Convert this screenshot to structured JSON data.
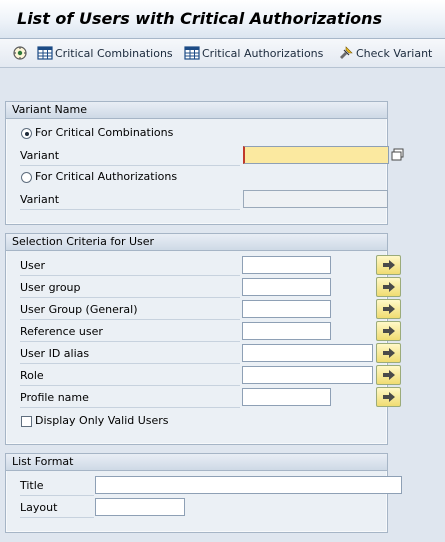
{
  "title": "List of Users with Critical Authorizations",
  "toolbar": {
    "items": [
      {
        "label": "",
        "icon": "execute-icon"
      },
      {
        "label": "Critical Combinations",
        "icon": "table-icon"
      },
      {
        "label": "Critical Authorizations",
        "icon": "table-icon"
      },
      {
        "label": "Check Variant",
        "icon": "check-variant-icon"
      }
    ]
  },
  "variant_group": {
    "title": "Variant Name",
    "radio_combinations": "For Critical Combinations",
    "radio_authorizations": "For Critical Authorizations",
    "variant_label_1": "Variant",
    "variant_label_2": "Variant",
    "variant_value_1": "",
    "variant_value_2": "",
    "selected": "For Critical Combinations"
  },
  "selection_group": {
    "title": "Selection Criteria for User",
    "fields": [
      {
        "label": "User",
        "value": ""
      },
      {
        "label": "User group",
        "value": ""
      },
      {
        "label": "User Group (General)",
        "value": ""
      },
      {
        "label": "Reference user",
        "value": ""
      },
      {
        "label": "User ID alias",
        "value": ""
      },
      {
        "label": "Role",
        "value": ""
      },
      {
        "label": "Profile name",
        "value": ""
      }
    ],
    "checkbox_label": "Display Only Valid Users",
    "checkbox_checked": false
  },
  "list_format_group": {
    "title": "List Format",
    "title_label": "Title",
    "layout_label": "Layout",
    "title_value": "",
    "layout_value": ""
  },
  "colors": {
    "background": "#dfe6ef",
    "required_field": "#fbe9a0",
    "arrow_button": "#f0dc72"
  }
}
